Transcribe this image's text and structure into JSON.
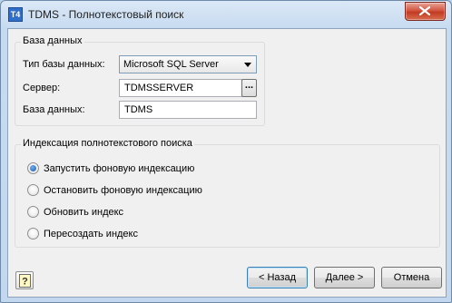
{
  "window": {
    "title": "TDMS - Полнотекстовый поиск",
    "app_icon": "T4"
  },
  "database_group": {
    "legend": "База данных",
    "type_label": "Тип базы данных:",
    "type_value": "Microsoft SQL Server",
    "server_label": "Сервер:",
    "server_value": "TDMSSERVER",
    "browse_label": "...",
    "db_label": "База данных:",
    "db_value": "TDMS"
  },
  "indexing_group": {
    "legend": "Индексация полнотекстового поиска",
    "options": [
      {
        "label": "Запустить фоновую индексацию",
        "selected": true
      },
      {
        "label": "Остановить фоновую индексацию",
        "selected": false
      },
      {
        "label": "Обновить индекс",
        "selected": false
      },
      {
        "label": "Пересоздать индекс",
        "selected": false
      }
    ]
  },
  "buttons": {
    "back": "< Назад",
    "next": "Далее >",
    "cancel": "Отмена"
  },
  "icons": {
    "close": "close-icon",
    "help": "help-icon",
    "dropdown": "chevron-down-icon"
  },
  "colors": {
    "accent": "#2f6fc9",
    "close_red": "#c23b22"
  }
}
